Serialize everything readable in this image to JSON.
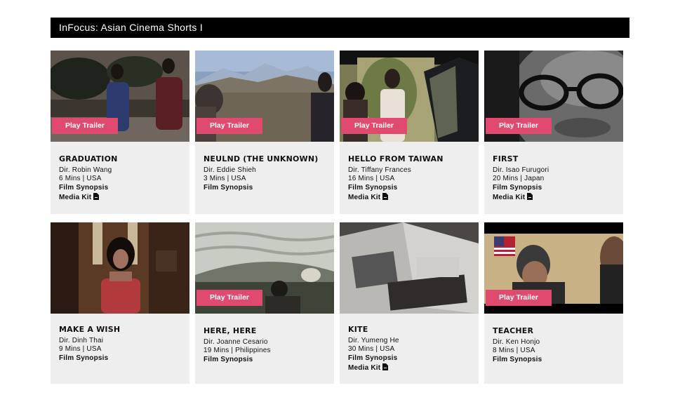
{
  "header": {
    "title": "InFocus: Asian Cinema Shorts I"
  },
  "play_label": "Play Trailer",
  "synopsis_label": "Film Synopsis",
  "media_kit_label": "Media Kit",
  "films": [
    {
      "title": "GRADUATION",
      "director": "Dir. Robin Wang",
      "details": "6 Mins | USA"
    },
    {
      "title": "NEULND (THE UNKNOWN)",
      "director": "Dir. Eddie Shieh",
      "details": "3 Mins | USA"
    },
    {
      "title": "HELLO FROM TAIWAN",
      "director": "Dir. Tiffany Frances",
      "details": "16 Mins | USA"
    },
    {
      "title": "FIRST",
      "director": "Dir. Isao Furugori",
      "details": "20 Mins | Japan"
    },
    {
      "title": "MAKE A WISH",
      "director": "Dir. Dinh Thai",
      "details": "9 Mins | USA"
    },
    {
      "title": "HERE, HERE",
      "director": "Dir. Joanne Cesario",
      "details": "19 Mins | Philippines"
    },
    {
      "title": "KITE",
      "director": "Dir. Yumeng He",
      "details": "30 Mins | USA"
    },
    {
      "title": "TEACHER",
      "director": "Dir. Ken Honjo",
      "details": "8 Mins | USA"
    }
  ]
}
